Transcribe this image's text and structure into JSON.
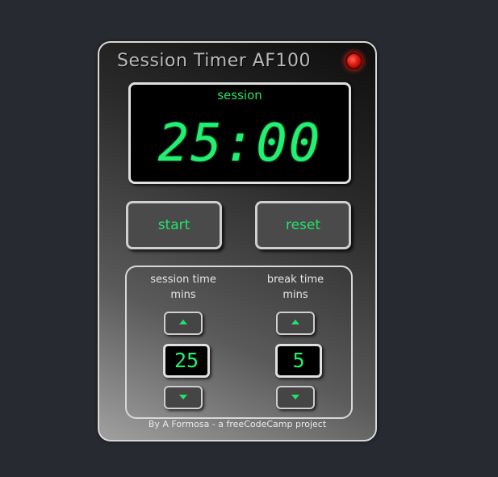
{
  "app": {
    "title": "Session Timer AF100",
    "credit": "By A Formosa - a freeCodeCamp project"
  },
  "display": {
    "label": "session",
    "time": "25:00"
  },
  "controls": {
    "start_label": "start",
    "reset_label": "reset"
  },
  "settings": {
    "session": {
      "label_line1": "session time",
      "label_line2": "mins",
      "value": "25"
    },
    "break": {
      "label_line1": "break time",
      "label_line2": "mins",
      "value": "5"
    }
  },
  "icons": {
    "indicator": "power-led-icon",
    "increment": "chevron-up-icon",
    "decrement": "chevron-down-icon"
  },
  "colors": {
    "page_background": "#272a30",
    "digit_green": "#22f06e",
    "led_red": "#e01a10",
    "bezel": "#d8d8d8"
  }
}
